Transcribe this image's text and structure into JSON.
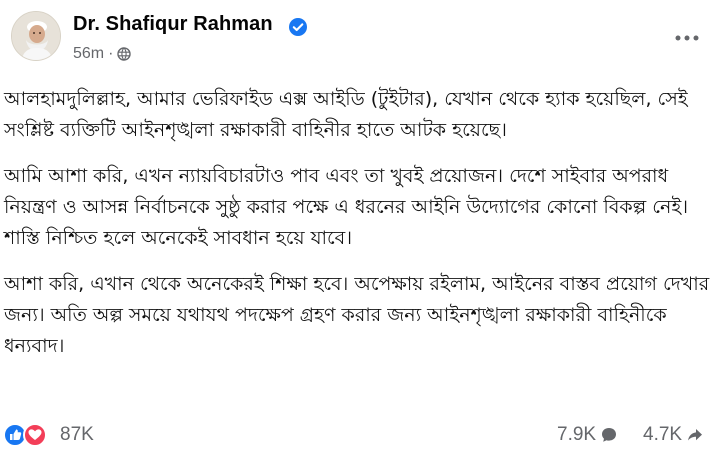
{
  "post": {
    "author": "Dr. Shafiqur Rahman",
    "time": "56m",
    "separator": "·",
    "paragraphs": [
      "আলহামদুলিল্লাহ, আমার ভেরিফাইড এক্স আইডি (টুইটার), যেখান থেকে হ্যাক হয়েছিল, সেই সংশ্লিষ্ট ব্যক্তিটি আইনশৃঙ্খলা রক্ষাকারী বাহিনীর হাতে আটক হয়েছে।",
      "আমি আশা করি, এখন ন্যায়বিচারটাও পাব এবং তা খুবই প্রয়োজন। দেশে সাইবার অপরাধ নিয়ন্ত্রণ ও আসন্ন নির্বাচনকে সুষ্ঠু করার পক্ষে এ ধরনের আইনি উদ্যোগের কোনো বিকল্প নেই। শাস্তি নিশ্চিত হলে অনেকেই সাবধান হয়ে যাবে।",
      "আশা করি, এখান থেকে অনেকেরই শিক্ষা হবে। অপেক্ষায় রইলাম, আইনের বাস্তব প্রয়োগ দেখার জন্য। অতি অল্প সময়ে যথাযথ পদক্ষেপ গ্রহণ করার জন্য আইনশৃঙ্খলা রক্ষাকারী বাহিনীকে ধন্যবাদ।"
    ]
  },
  "stats": {
    "reactions": "87K",
    "comments": "7.9K",
    "shares": "4.7K"
  },
  "icons": {
    "verified": "verified-badge-icon",
    "privacy": "globe-icon",
    "more": "more-options-icon",
    "like": "like-icon",
    "love": "love-icon",
    "comment": "comment-icon",
    "share": "share-icon"
  },
  "colors": {
    "brand_blue": "#1877f2",
    "love_red": "#f33e58",
    "secondary_text": "#65676b"
  }
}
